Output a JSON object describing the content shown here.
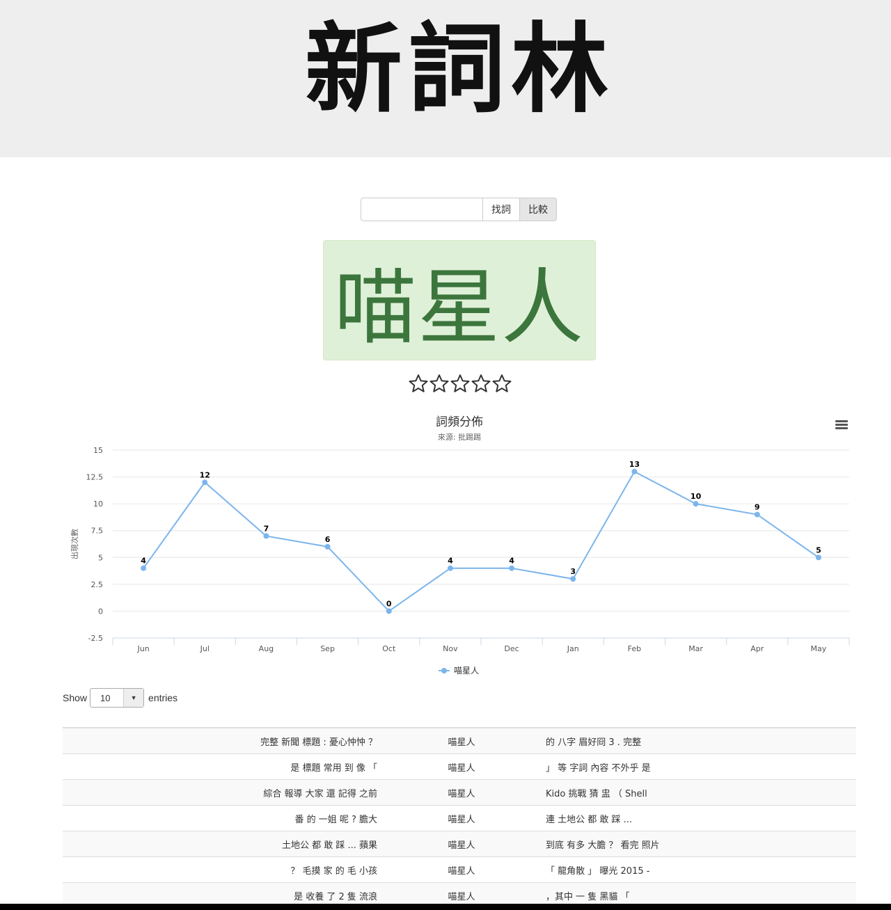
{
  "header": {
    "logo_text": "新詞林"
  },
  "search": {
    "value": "",
    "find_label": "找詞",
    "compare_label": "比較"
  },
  "word": {
    "text": "喵星人"
  },
  "rating": {
    "stars_filled": 0,
    "stars_total": 5
  },
  "chart_data": {
    "type": "line",
    "title": "詞頻分佈",
    "subtitle": "來源: 批踢踢",
    "ylabel": "出現次數",
    "xlabel": "",
    "categories": [
      "Jun",
      "Jul",
      "Aug",
      "Sep",
      "Oct",
      "Nov",
      "Dec",
      "Jan",
      "Feb",
      "Mar",
      "Apr",
      "May"
    ],
    "series": [
      {
        "name": "喵星人",
        "values": [
          4,
          12,
          7,
          6,
          0,
          4,
          4,
          3,
          13,
          10,
          9,
          5
        ],
        "color": "#7cb5ec"
      }
    ],
    "ylim": [
      -2.5,
      15
    ],
    "yticks": [
      "-2.5",
      "0",
      "2.5",
      "5",
      "7.5",
      "10",
      "12.5",
      "15"
    ],
    "grid": true,
    "legend": "bottom-center",
    "data_labels": true
  },
  "table_controls": {
    "show_label": "Show",
    "page_size": "10",
    "entries_label": "entries"
  },
  "kwic_rows": [
    {
      "left": "完整 新聞 標題 : 憂心忡忡 ？",
      "keyword": "喵星人",
      "right": "的 八字 眉好冏 3 . 完整"
    },
    {
      "left": "是 標題 常用 到 像 「",
      "keyword": "喵星人",
      "right": "」 等 字詞 內容 不外乎 是"
    },
    {
      "left": "綜合 報導 大家 還 記得 之前",
      "keyword": "喵星人",
      "right": "Kido 挑戰 猜 盅 （ Shell"
    },
    {
      "left": "番 的 一姐 呢 ? 膽大",
      "keyword": "喵星人",
      "right": "連 土地公 都 敢 踩 ..."
    },
    {
      "left": "土地公 都 敢 踩 ... 蘋果",
      "keyword": "喵星人",
      "right": "到底 有多 大膽 ？ 看完 照片"
    },
    {
      "left": "？ 毛摸 家 的 毛 小孩",
      "keyword": "喵星人",
      "right": "「 龍角散 」 曝光 2015 -"
    },
    {
      "left": "是 收養 了 2 隻 流浪",
      "keyword": "喵星人",
      "right": "，其中 一 隻 黑貓 「"
    }
  ]
}
